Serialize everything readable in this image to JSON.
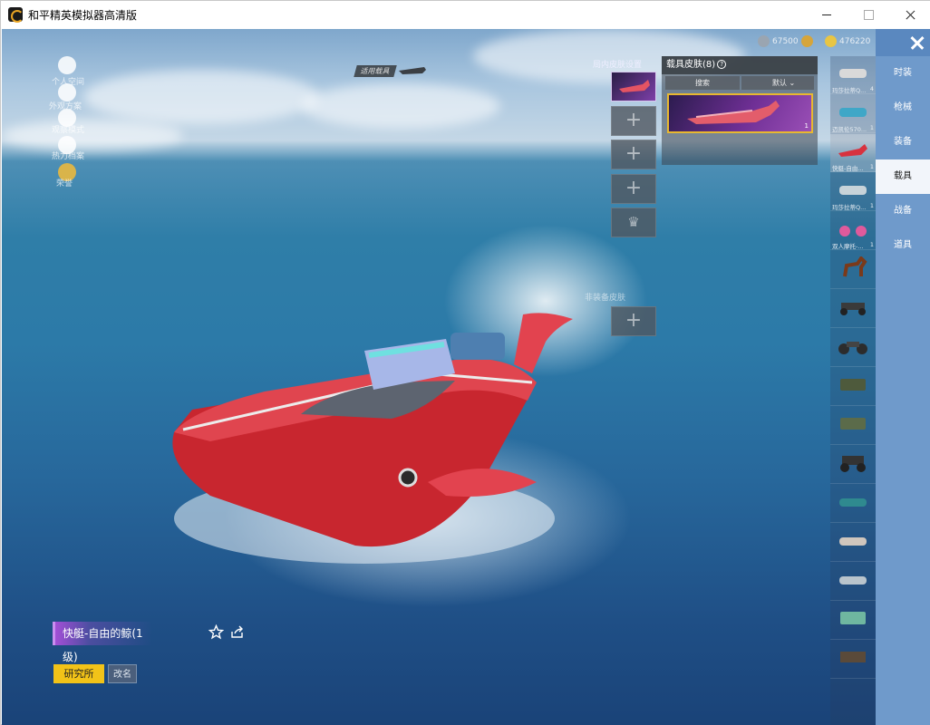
{
  "window": {
    "title": "和平精英模拟器高清版"
  },
  "currency": {
    "coupons": "67500",
    "gold": "476220"
  },
  "left_menu": [
    {
      "label": "个人空间"
    },
    {
      "label": "外观方案"
    },
    {
      "label": "观察模式"
    },
    {
      "label": "热力档案"
    },
    {
      "label": "荣誉"
    }
  ],
  "applied_vehicle": {
    "label": "适用载具"
  },
  "skin_slots": {
    "title": "局内皮肤设置",
    "secondary_label": "非装备皮肤",
    "add_symbol": "+",
    "crown_symbol": "♛"
  },
  "skin_panel": {
    "title": "载具皮肤",
    "count": "(8)",
    "help": "?",
    "search_label": "搜索",
    "sort_label": "默认",
    "card_count": "1"
  },
  "vehicles": [
    {
      "name": "玛莎拉蒂Q...",
      "count": "4"
    },
    {
      "name": "迈凯伦570...",
      "count": "1"
    },
    {
      "name": "快艇-自由...",
      "count": "1"
    },
    {
      "name": "玛莎拉蒂Q...",
      "count": "1"
    },
    {
      "name": "双人摩托-...",
      "count": "1"
    },
    {
      "name": "",
      "count": ""
    },
    {
      "name": "",
      "count": ""
    },
    {
      "name": "",
      "count": ""
    },
    {
      "name": "",
      "count": ""
    },
    {
      "name": "",
      "count": ""
    },
    {
      "name": "",
      "count": ""
    },
    {
      "name": "",
      "count": ""
    },
    {
      "name": "",
      "count": ""
    },
    {
      "name": "",
      "count": ""
    },
    {
      "name": "",
      "count": ""
    },
    {
      "name": "",
      "count": ""
    },
    {
      "name": "",
      "count": ""
    }
  ],
  "categories": [
    {
      "label": "时装"
    },
    {
      "label": "枪械"
    },
    {
      "label": "装备"
    },
    {
      "label": "载具"
    },
    {
      "label": "战备"
    },
    {
      "label": "道具"
    }
  ],
  "selected": {
    "vehicle_name": "快艇-自由的鲸(1级)",
    "research_button": "研究所",
    "rename_button": "改名"
  },
  "colors": {
    "accent_yellow": "#f2c318",
    "category_blue": "#6f9acb",
    "boat_red": "#d8323f",
    "skin_purple": "#7d3fa8"
  }
}
